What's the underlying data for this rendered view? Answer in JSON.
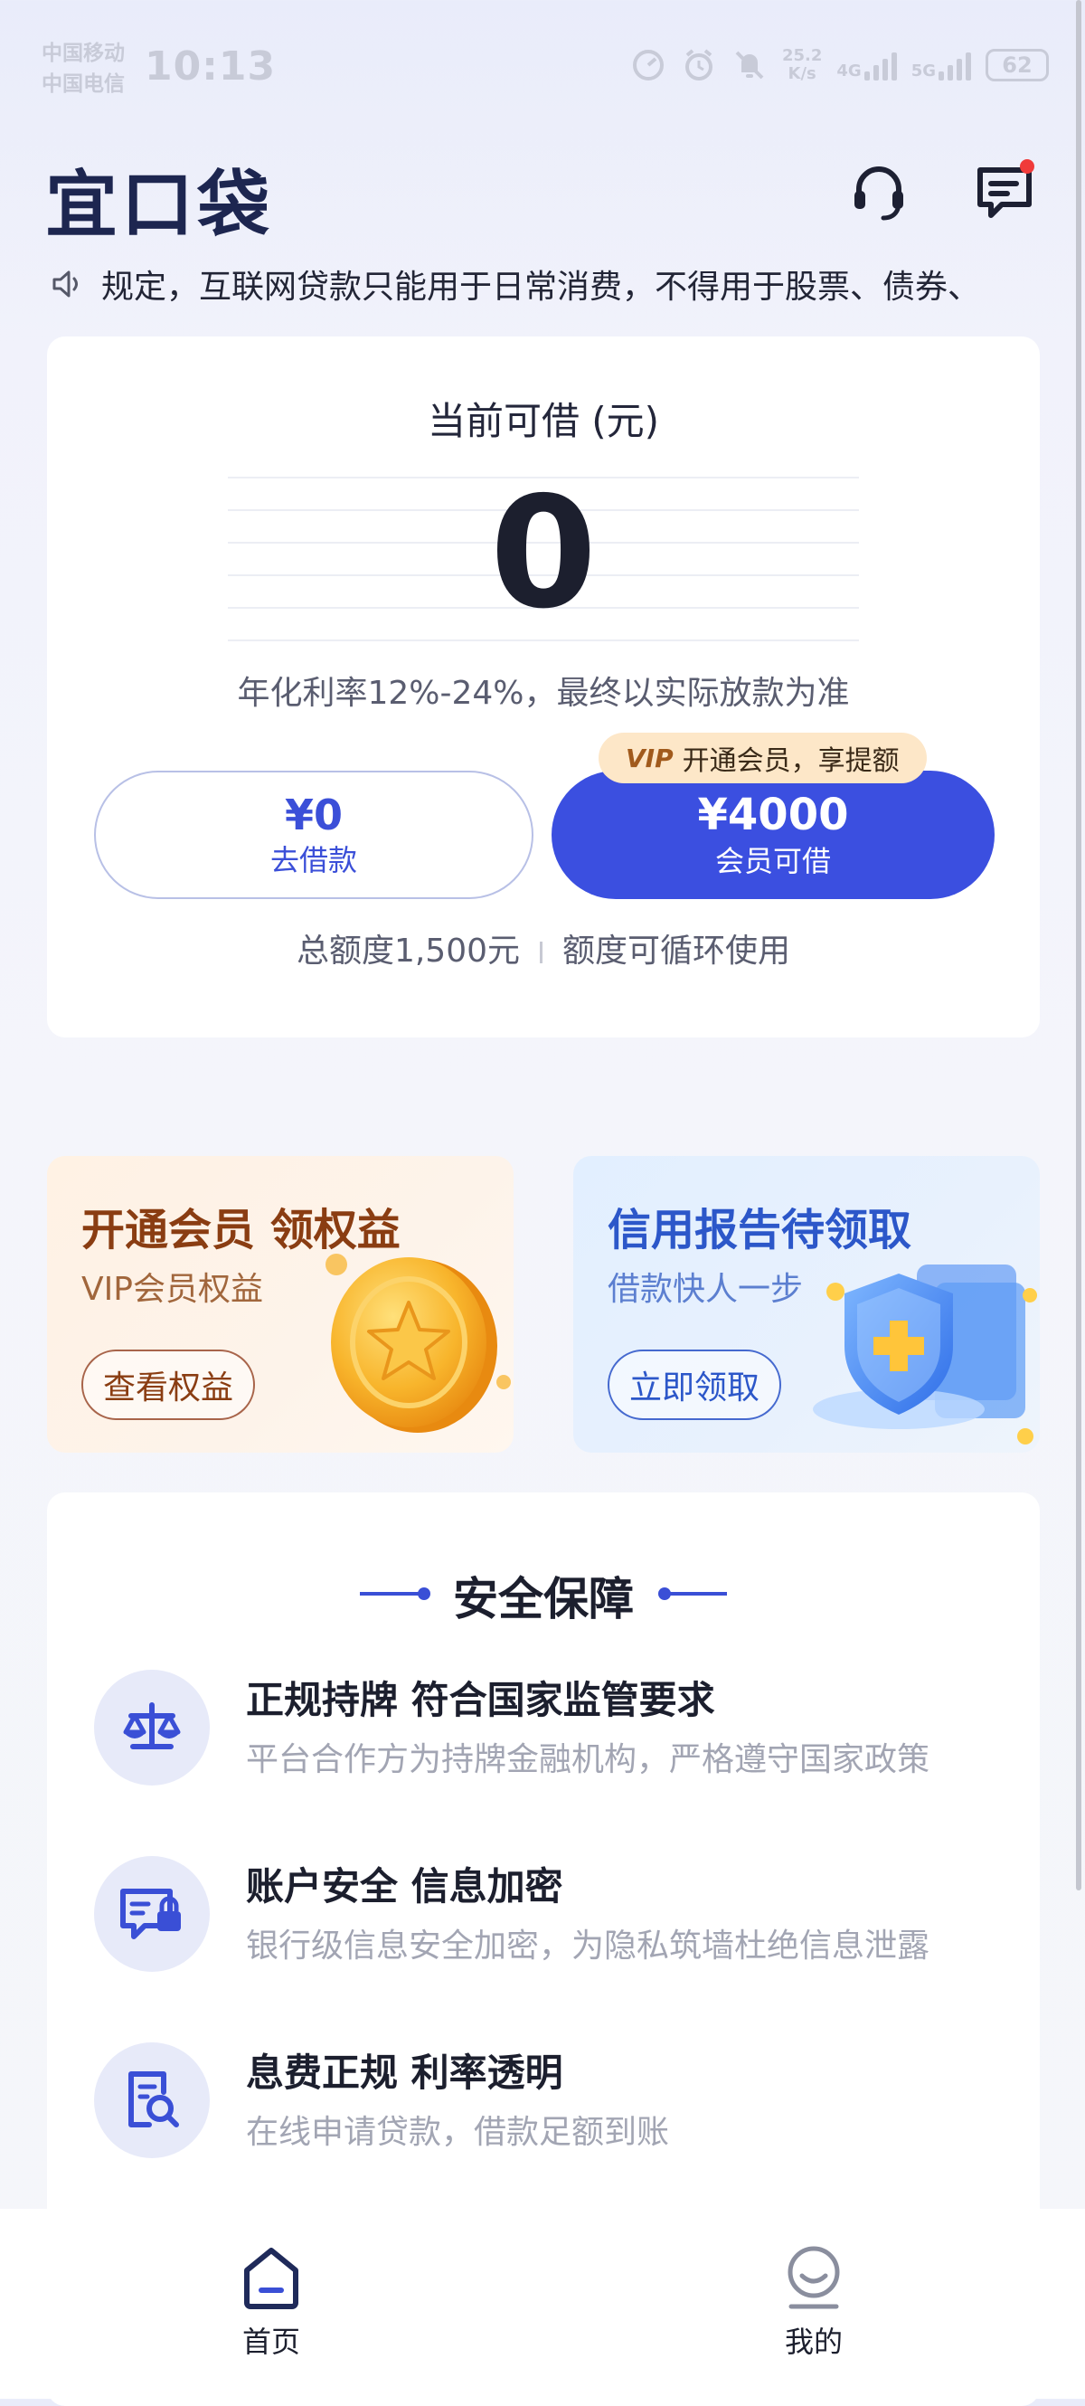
{
  "status_bar": {
    "carrier1": "中国移动",
    "carrier2": "中国电信",
    "time": "10:13",
    "net_speed_value": "25.2",
    "net_speed_unit": "K/s",
    "net1": "4G",
    "net2": "5G",
    "battery": "62"
  },
  "header": {
    "logo": "宜口袋",
    "notice": "规定，互联网贷款只能用于日常消费，不得用于股票、债券、"
  },
  "loan_card": {
    "title": "当前可借 (元)",
    "amount": "0",
    "rate": "年化利率12%-24%，最终以实际放款为准",
    "loan_button": {
      "amount": "¥0",
      "label": "去借款"
    },
    "vip_badge": {
      "tag": "VIP",
      "text": "开通会员，享提额"
    },
    "vip_button": {
      "amount": "¥4000",
      "label": "会员可借"
    },
    "quota_total": "总额度1,500元",
    "quota_note": "额度可循环使用"
  },
  "promos": {
    "vip": {
      "title": "开通会员 领权益",
      "sub": "VIP会员权益",
      "button": "查看权益"
    },
    "credit": {
      "title": "信用报告待领取",
      "sub": "借款快人一步",
      "button": "立即领取"
    }
  },
  "safety": {
    "title": "安全保障",
    "items": [
      {
        "title": "正规持牌 符合国家监管要求",
        "desc": "平台合作方为持牌金融机构，严格遵守国家政策",
        "icon": "scale-icon"
      },
      {
        "title": "账户安全 信息加密",
        "desc": "银行级信息安全加密，为隐私筑墙杜绝信息泄露",
        "icon": "secure-card-icon"
      },
      {
        "title": "息费正规  利率透明",
        "desc": "在线申请贷款，借款足额到账",
        "icon": "document-search-icon"
      }
    ]
  },
  "nav": {
    "home": "首页",
    "mine": "我的"
  },
  "colors": {
    "primary": "#3b4fe0",
    "brand_dark": "#1d2650",
    "vip_gold": "#fde7c8"
  }
}
